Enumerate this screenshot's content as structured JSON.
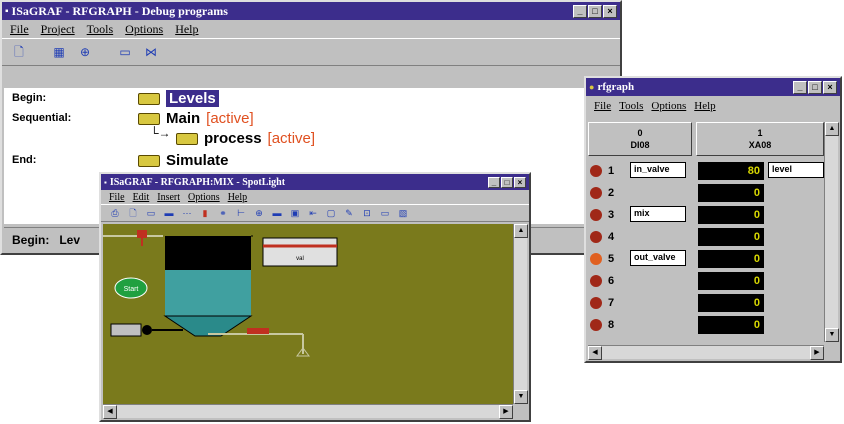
{
  "main": {
    "title": "ISaGRAF - RFGRAPH - Debug programs",
    "menu": [
      "File",
      "Project",
      "Tools",
      "Options",
      "Help"
    ],
    "rows": {
      "begin_label": "Begin:",
      "begin_step": "Levels",
      "seq_label": "Sequential:",
      "main_step": "Main",
      "main_state": "[active]",
      "process_step": "process",
      "process_state": "[active]",
      "end_label": "End:",
      "end_step": "Simulate"
    },
    "status_label": "Begin:",
    "status_text": "Lev"
  },
  "spot": {
    "title": "ISaGRAF - RFGRAPH:MIX - SpotLight",
    "menu": [
      "File",
      "Edit",
      "Insert",
      "Options",
      "Help"
    ],
    "button_label": "Start",
    "panel_label": "val"
  },
  "rf": {
    "title": "rfgraph",
    "menu": [
      "File",
      "Tools",
      "Options",
      "Help"
    ],
    "col0": {
      "num": "0",
      "name": "DI08"
    },
    "col1": {
      "num": "1",
      "name": "XA08"
    },
    "rows": [
      {
        "idx": "1",
        "label": "in_valve",
        "value": "80",
        "tag": "level"
      },
      {
        "idx": "2",
        "label": "",
        "value": "0",
        "tag": ""
      },
      {
        "idx": "3",
        "label": "mix",
        "value": "0",
        "tag": ""
      },
      {
        "idx": "4",
        "label": "",
        "value": "0",
        "tag": ""
      },
      {
        "idx": "5",
        "label": "out_valve",
        "value": "0",
        "tag": ""
      },
      {
        "idx": "6",
        "label": "",
        "value": "0",
        "tag": ""
      },
      {
        "idx": "7",
        "label": "",
        "value": "0",
        "tag": ""
      },
      {
        "idx": "8",
        "label": "",
        "value": "0",
        "tag": ""
      }
    ]
  },
  "colors": {
    "titlebar": "#3c2d8c",
    "active": "#e05020",
    "canvas": "#7a7a1c",
    "tank": "#40a0a0",
    "led": "#a02818"
  }
}
